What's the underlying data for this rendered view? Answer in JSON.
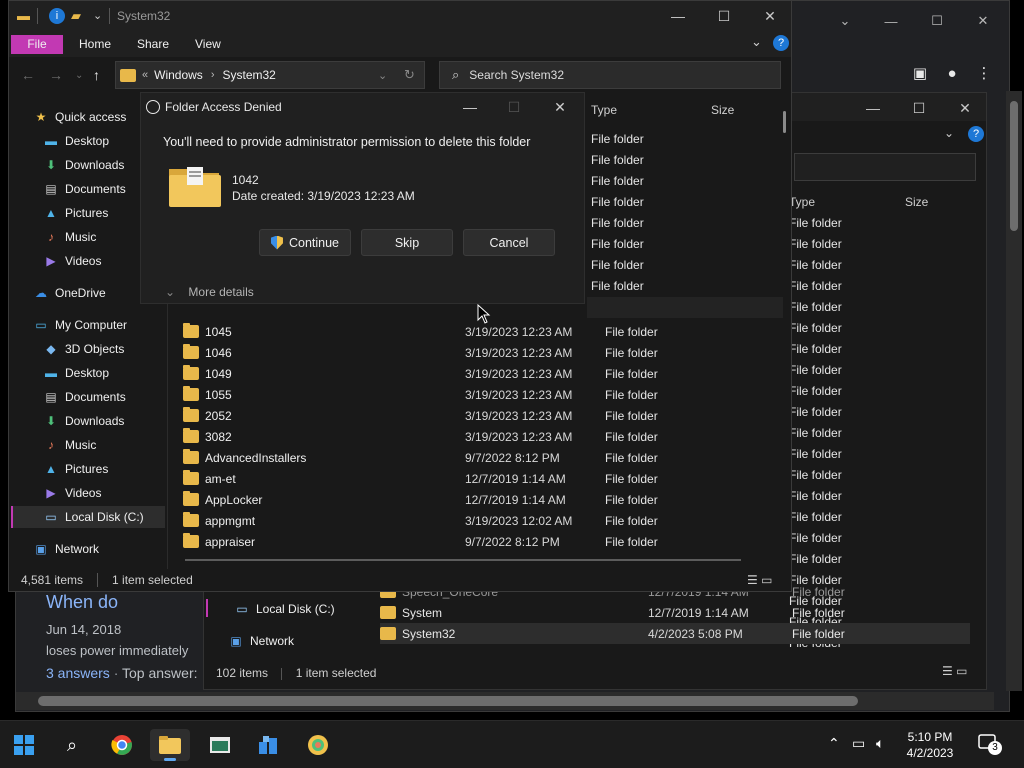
{
  "browser": {
    "tab_controls": [
      "⌄",
      "—",
      "☐",
      "✕"
    ],
    "toolbar_icons": [
      "sidebar",
      "profile",
      "menu"
    ],
    "result": {
      "title": "When do",
      "meta": "Jun 14, 2018",
      "snippet": "loses power immediately",
      "answers_count": "3 answers",
      "top_answer_label": "Top answer:"
    }
  },
  "explorer_back": {
    "nav": {
      "local_disk": "Local Disk (C:)",
      "network": "Network"
    },
    "columns": {
      "type": "Type",
      "size": "Size"
    },
    "type_value": "File folder",
    "type_rows_count": 21,
    "rows": [
      {
        "name": "Speech_OneCore",
        "date": "12/7/2019 1:14 AM",
        "type": "File folder"
      },
      {
        "name": "System",
        "date": "12/7/2019 1:14 AM",
        "type": "File folder"
      },
      {
        "name": "System32",
        "date": "4/2/2023 5:08 PM",
        "type": "File folder"
      }
    ],
    "status": {
      "items": "102 items",
      "selected": "1 item selected"
    }
  },
  "explorer": {
    "title": "System32",
    "menu": {
      "file": "File",
      "home": "Home",
      "share": "Share",
      "view": "View"
    },
    "address": {
      "crumb1": "Windows",
      "crumb2": "System32"
    },
    "search": {
      "placeholder": "Search System32"
    },
    "nav": {
      "quick_access": "Quick access",
      "qa_items": [
        "Desktop",
        "Downloads",
        "Documents",
        "Pictures",
        "Music",
        "Videos"
      ],
      "onedrive": "OneDrive",
      "my_computer": "My Computer",
      "pc_items": [
        "3D Objects",
        "Desktop",
        "Documents",
        "Downloads",
        "Music",
        "Pictures",
        "Videos"
      ],
      "local_disk": "Local Disk (C:)",
      "network": "Network"
    },
    "columns": {
      "type": "Type",
      "size": "Size"
    },
    "type_value": "File folder",
    "rows": [
      {
        "name": "1045",
        "date": "3/19/2023 12:23 AM",
        "type": "File folder"
      },
      {
        "name": "1046",
        "date": "3/19/2023 12:23 AM",
        "type": "File folder"
      },
      {
        "name": "1049",
        "date": "3/19/2023 12:23 AM",
        "type": "File folder"
      },
      {
        "name": "1055",
        "date": "3/19/2023 12:23 AM",
        "type": "File folder"
      },
      {
        "name": "2052",
        "date": "3/19/2023 12:23 AM",
        "type": "File folder"
      },
      {
        "name": "3082",
        "date": "3/19/2023 12:23 AM",
        "type": "File folder"
      },
      {
        "name": "AdvancedInstallers",
        "date": "9/7/2022 8:12 PM",
        "type": "File folder"
      },
      {
        "name": "am-et",
        "date": "12/7/2019 1:14 AM",
        "type": "File folder"
      },
      {
        "name": "AppLocker",
        "date": "12/7/2019 1:14 AM",
        "type": "File folder"
      },
      {
        "name": "appmgmt",
        "date": "3/19/2023 12:02 AM",
        "type": "File folder"
      },
      {
        "name": "appraiser",
        "date": "9/7/2022 8:12 PM",
        "type": "File folder"
      }
    ],
    "status": {
      "items": "4,581 items",
      "selected": "1 item selected"
    }
  },
  "dialog": {
    "title": "Folder Access Denied",
    "message": "You'll need to provide administrator permission to delete this folder",
    "folder_name": "1042",
    "date_created": "Date created: 3/19/2023 12:23 AM",
    "buttons": {
      "continue": "Continue",
      "skip": "Skip",
      "cancel": "Cancel"
    },
    "more_details": "More details"
  },
  "taskbar": {
    "apps": [
      "start",
      "search",
      "chrome",
      "file-explorer",
      "terminal",
      "control-panel",
      "other-app"
    ],
    "time": "5:10 PM",
    "date": "4/2/2023",
    "notification_count": "3"
  },
  "colors": {
    "accent": "#c239b3",
    "folder": "#e8b84a",
    "link": "#8ab4f8"
  }
}
